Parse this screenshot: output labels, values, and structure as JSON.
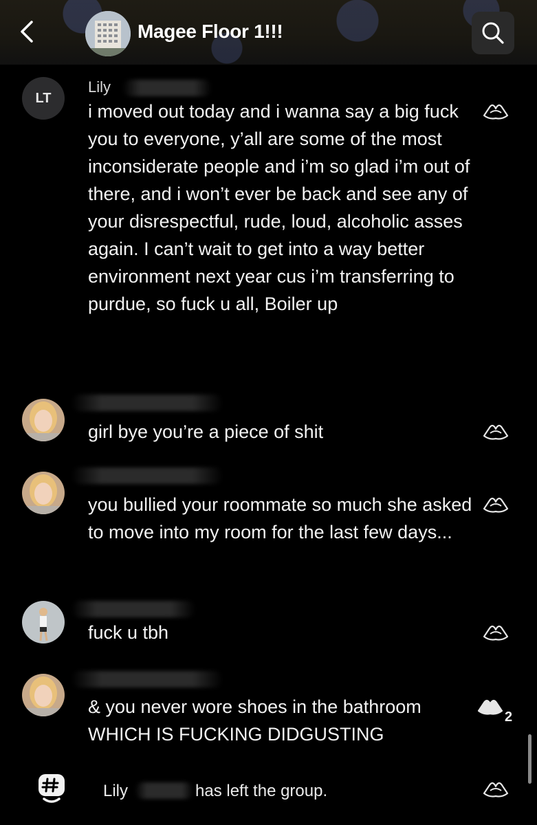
{
  "header": {
    "title": "Magee Floor 1!!!",
    "back_icon": "chevron-left-icon",
    "search_icon": "search-icon"
  },
  "messages": [
    {
      "sender": "Lily",
      "avatar_initials": "LT",
      "text": "i moved out today and i wanna say a big fuck you to everyone, y’all are some of the most inconsiderate people and i’m so glad i’m out of there, and i won’t ever be back and see any of your disrespectful, rude, loud, alcoholic asses again. I can’t wait to get into a way better environment next year cus i’m transferring to purdue, so fuck u all, Boiler up"
    },
    {
      "text": "girl bye you’re a piece of shit"
    },
    {
      "text": "you bullied your roommate so much she asked to move into my room for the last few days..."
    },
    {
      "text": "fuck u tbh"
    },
    {
      "text": "& you never wore shoes in the bathroom WHICH IS FUCKING DIDGUSTING",
      "like_count": "2"
    }
  ],
  "system": {
    "name": "Lily",
    "text": "has left the group.",
    "icon": "groupme-hashtag-icon"
  },
  "colors": {
    "background": "#000000",
    "text": "#f2f2f2",
    "header": "#1b1913"
  }
}
